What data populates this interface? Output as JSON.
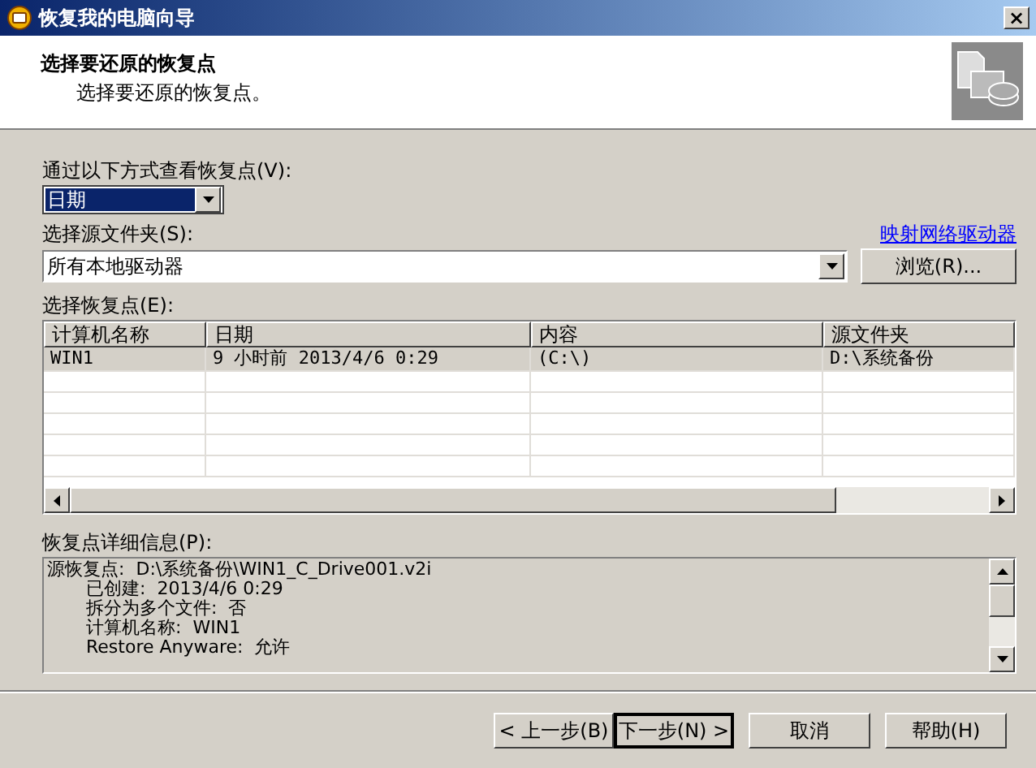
{
  "window": {
    "title": "恢复我的电脑向导",
    "close": "×"
  },
  "header": {
    "title": "选择要还原的恢复点",
    "subtitle": "选择要还原的恢复点。"
  },
  "view_by": {
    "label": "通过以下方式查看恢复点(V):",
    "value": "日期"
  },
  "source": {
    "label": "选择源文件夹(S):",
    "link": "映射网络驱动器",
    "value": "所有本地驱动器",
    "browse": "浏览(R)..."
  },
  "points": {
    "label": "选择恢复点(E):",
    "columns": [
      "计算机名称",
      "日期",
      "内容",
      "源文件夹"
    ],
    "rows": [
      {
        "cells": [
          "WIN1",
          "9 小时前 2013/4/6 0:29",
          "(C:\\)",
          "D:\\系统备份"
        ],
        "selected": true
      }
    ]
  },
  "details": {
    "label": "恢复点详细信息(P):",
    "lines": [
      {
        "label": "源恢复点:",
        "value": "D:\\系统备份\\WIN1_C_Drive001.v2i",
        "indent": false
      },
      {
        "label": "已创建:",
        "value": "2013/4/6 0:29",
        "indent": true
      },
      {
        "label": "拆分为多个文件:",
        "value": "否",
        "indent": true
      },
      {
        "label": "计算机名称:",
        "value": "WIN1",
        "indent": true
      },
      {
        "label": "Restore Anyware:",
        "value": "允许",
        "indent": true
      }
    ]
  },
  "buttons": [
    {
      "label": "< 上一步(B)",
      "default": false
    },
    {
      "label": "下一步(N) >",
      "default": true
    },
    {
      "label": "取消",
      "default": false
    },
    {
      "label": "帮助(H)",
      "default": false
    }
  ]
}
